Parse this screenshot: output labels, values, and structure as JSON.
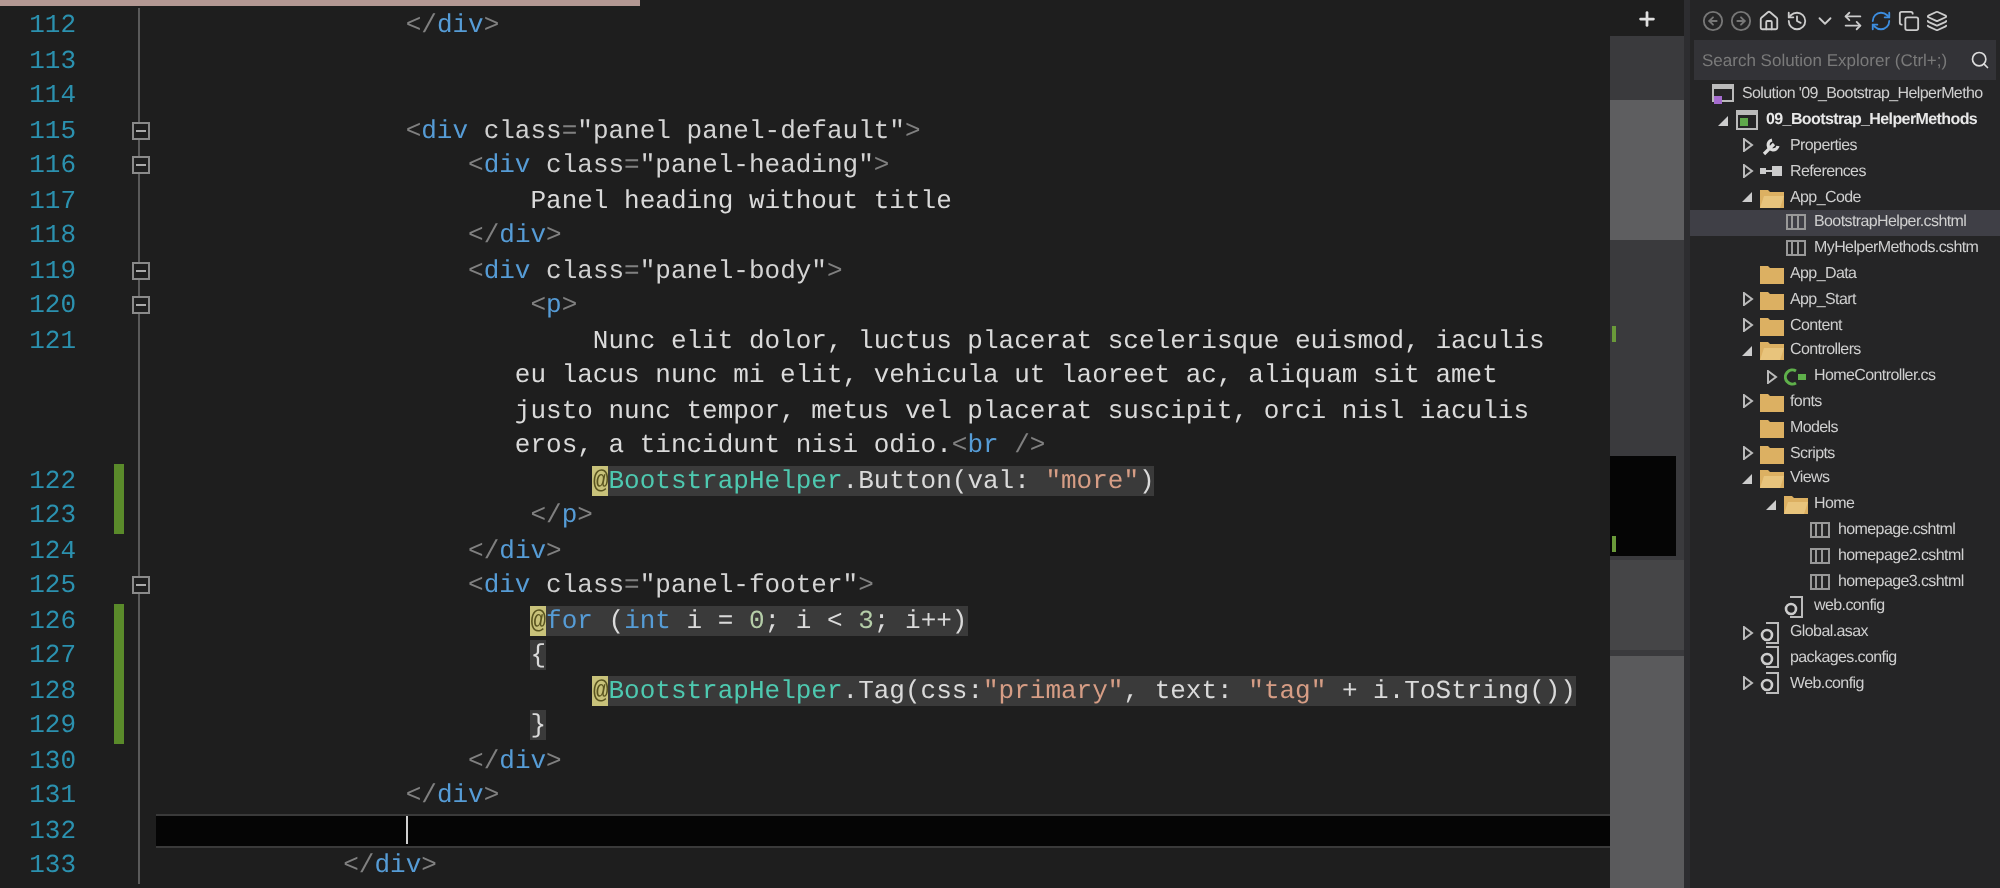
{
  "editor": {
    "lines": [
      {
        "number": "112",
        "changed": false,
        "foldable": false,
        "current": false,
        "razor": false,
        "tokens": [
          {
            "kind": "punct",
            "text": "                </"
          },
          {
            "kind": "tag",
            "text": "div"
          },
          {
            "kind": "punct",
            "text": ">"
          }
        ]
      },
      {
        "number": "113",
        "changed": false,
        "foldable": false,
        "current": false
      },
      {
        "number": "114",
        "changed": false,
        "foldable": false,
        "current": false
      },
      {
        "number": "115",
        "changed": false,
        "foldable": true,
        "current": false,
        "razor": false,
        "tokens": [
          {
            "kind": "punct",
            "text": "                <"
          },
          {
            "kind": "tag",
            "text": "div"
          },
          {
            "kind": "attr",
            "text": " class"
          },
          {
            "kind": "punct",
            "text": "="
          },
          {
            "kind": "value",
            "text": "\"panel panel-default\""
          },
          {
            "kind": "punct",
            "text": ">"
          }
        ]
      },
      {
        "number": "116",
        "changed": false,
        "foldable": true,
        "current": false,
        "razor": false,
        "tokens": [
          {
            "kind": "punct",
            "text": "                    <"
          },
          {
            "kind": "tag",
            "text": "div"
          },
          {
            "kind": "attr",
            "text": " class"
          },
          {
            "kind": "punct",
            "text": "="
          },
          {
            "kind": "value",
            "text": "\"panel-heading\""
          },
          {
            "kind": "punct",
            "text": ">"
          }
        ]
      },
      {
        "number": "117",
        "changed": false,
        "foldable": false,
        "current": false,
        "razor": false,
        "tokens": [
          {
            "kind": "plain",
            "text": "                        Panel heading without title"
          }
        ]
      },
      {
        "number": "118",
        "changed": false,
        "foldable": false,
        "current": false,
        "razor": false,
        "tokens": [
          {
            "kind": "punct",
            "text": "                    </"
          },
          {
            "kind": "tag",
            "text": "div"
          },
          {
            "kind": "punct",
            "text": ">"
          }
        ]
      },
      {
        "number": "119",
        "changed": false,
        "foldable": true,
        "current": false,
        "razor": false,
        "tokens": [
          {
            "kind": "punct",
            "text": "                    <"
          },
          {
            "kind": "tag",
            "text": "div"
          },
          {
            "kind": "attr",
            "text": " class"
          },
          {
            "kind": "punct",
            "text": "="
          },
          {
            "kind": "value",
            "text": "\"panel-body\""
          },
          {
            "kind": "punct",
            "text": ">"
          }
        ]
      },
      {
        "number": "120",
        "changed": false,
        "foldable": true,
        "current": false,
        "razor": false,
        "tokens": [
          {
            "kind": "punct",
            "text": "                        <"
          },
          {
            "kind": "tag",
            "text": "p"
          },
          {
            "kind": "punct",
            "text": ">"
          }
        ]
      },
      {
        "number": "121",
        "changed": false,
        "foldable": false,
        "current": false,
        "razor": false,
        "tokens": [
          {
            "kind": "plain",
            "text": "                            Nunc elit dolor, luctus placerat scelerisque euismod, iaculis"
          }
        ]
      },
      {
        "changed": false,
        "foldable": false,
        "current": false,
        "razor": false,
        "tokens": [
          {
            "kind": "plain",
            "text": "                       eu lacus nunc mi elit, vehicula ut laoreet ac, aliquam sit amet"
          }
        ]
      },
      {
        "changed": false,
        "foldable": false,
        "current": false,
        "razor": false,
        "tokens": [
          {
            "kind": "plain",
            "text": "                       justo nunc tempor, metus vel placerat suscipit, orci nisl iaculis"
          }
        ]
      },
      {
        "changed": false,
        "foldable": false,
        "current": false,
        "razor": false,
        "tokens": [
          {
            "kind": "plain",
            "text": "                       eros, a tincidunt nisi odio."
          },
          {
            "kind": "punct",
            "text": "<"
          },
          {
            "kind": "tag",
            "text": "br"
          },
          {
            "kind": "punct",
            "text": " />"
          }
        ]
      },
      {
        "number": "122",
        "changed": true,
        "foldable": false,
        "current": false,
        "razor": true,
        "tokens": [
          {
            "kind": "marker",
            "text": "                            @"
          },
          {
            "kind": "type",
            "text": "BootstrapHelper"
          },
          {
            "kind": "plain",
            "text": ".Button(val: "
          },
          {
            "kind": "string",
            "text": "\"more\""
          },
          {
            "kind": "plain",
            "text": ")"
          }
        ]
      },
      {
        "number": "123",
        "changed": true,
        "foldable": false,
        "current": false,
        "razor": false,
        "tokens": [
          {
            "kind": "punct",
            "text": "                        </"
          },
          {
            "kind": "tag",
            "text": "p"
          },
          {
            "kind": "punct",
            "text": ">"
          }
        ]
      },
      {
        "number": "124",
        "changed": false,
        "foldable": false,
        "current": false,
        "razor": false,
        "tokens": [
          {
            "kind": "punct",
            "text": "                    </"
          },
          {
            "kind": "tag",
            "text": "div"
          },
          {
            "kind": "punct",
            "text": ">"
          }
        ]
      },
      {
        "number": "125",
        "changed": false,
        "foldable": true,
        "current": false,
        "razor": false,
        "tokens": [
          {
            "kind": "punct",
            "text": "                    <"
          },
          {
            "kind": "tag",
            "text": "div"
          },
          {
            "kind": "attr",
            "text": " class"
          },
          {
            "kind": "punct",
            "text": "="
          },
          {
            "kind": "value",
            "text": "\"panel-footer\""
          },
          {
            "kind": "punct",
            "text": ">"
          }
        ]
      },
      {
        "number": "126",
        "changed": true,
        "foldable": false,
        "current": false,
        "razor": true,
        "tokens": [
          {
            "kind": "marker",
            "text": "                        @"
          },
          {
            "kind": "keyword",
            "text": "for"
          },
          {
            "kind": "plain",
            "text": " ("
          },
          {
            "kind": "keyword",
            "text": "int"
          },
          {
            "kind": "plain",
            "text": " i = "
          },
          {
            "kind": "number",
            "text": "0"
          },
          {
            "kind": "plain",
            "text": "; i < "
          },
          {
            "kind": "number",
            "text": "3"
          },
          {
            "kind": "plain",
            "text": "; i++)"
          }
        ]
      },
      {
        "number": "127",
        "changed": true,
        "foldable": false,
        "current": false,
        "razor": true,
        "tokens": [
          {
            "kind": "plain",
            "text": "                        {"
          }
        ]
      },
      {
        "number": "128",
        "changed": true,
        "foldable": false,
        "current": false,
        "razor": true,
        "tokens": [
          {
            "kind": "marker",
            "text": "                            @"
          },
          {
            "kind": "type",
            "text": "BootstrapHelper"
          },
          {
            "kind": "plain",
            "text": ".Tag(css:"
          },
          {
            "kind": "string",
            "text": "\"primary\""
          },
          {
            "kind": "plain",
            "text": ", text: "
          },
          {
            "kind": "string",
            "text": "\"tag\""
          },
          {
            "kind": "plain",
            "text": " + i.ToString())"
          }
        ]
      },
      {
        "number": "129",
        "changed": true,
        "foldable": false,
        "current": false,
        "razor": true,
        "tokens": [
          {
            "kind": "plain",
            "text": "                        }"
          }
        ]
      },
      {
        "number": "130",
        "changed": false,
        "foldable": false,
        "current": false,
        "razor": false,
        "tokens": [
          {
            "kind": "punct",
            "text": "                    </"
          },
          {
            "kind": "tag",
            "text": "div"
          },
          {
            "kind": "punct",
            "text": ">"
          }
        ]
      },
      {
        "number": "131",
        "changed": false,
        "foldable": false,
        "current": false,
        "razor": false,
        "tokens": [
          {
            "kind": "punct",
            "text": "                </"
          },
          {
            "kind": "tag",
            "text": "div"
          },
          {
            "kind": "punct",
            "text": ">"
          }
        ]
      },
      {
        "number": "132",
        "changed": false,
        "foldable": false,
        "current": true
      },
      {
        "number": "133",
        "changed": false,
        "foldable": false,
        "current": false,
        "razor": false,
        "tokens": [
          {
            "kind": "punct",
            "text": "            </"
          },
          {
            "kind": "tag",
            "text": "div"
          },
          {
            "kind": "punct",
            "text": ">"
          }
        ]
      }
    ]
  },
  "solution_explorer": {
    "search": {
      "placeholder": "Search Solution Explorer (Ctrl+;)"
    },
    "tree": [
      {
        "label": "Solution '09_Bootstrap_HelperMetho",
        "kind": "solution",
        "selected": false,
        "children": [
          {
            "label": "09_Bootstrap_HelperMethods",
            "kind": "project",
            "expanded": true,
            "selected": false,
            "children": [
              {
                "label": "Properties",
                "kind": "wrench",
                "expanded": false,
                "selected": false
              },
              {
                "label": "References",
                "kind": "references",
                "expanded": false,
                "selected": false
              },
              {
                "label": "App_Code",
                "kind": "folder",
                "expanded": true,
                "selected": false,
                "children": [
                  {
                    "label": "BootstrapHelper.cshtml",
                    "kind": "file",
                    "selected": true
                  },
                  {
                    "label": "MyHelperMethods.cshtm",
                    "kind": "file",
                    "selected": false
                  }
                ]
              },
              {
                "label": "App_Data",
                "kind": "folder",
                "selected": false
              },
              {
                "label": "App_Start",
                "kind": "folder",
                "expanded": false,
                "selected": false
              },
              {
                "label": "Content",
                "kind": "folder",
                "expanded": false,
                "selected": false
              },
              {
                "label": "Controllers",
                "kind": "folder",
                "expanded": true,
                "selected": false,
                "children": [
                  {
                    "label": "HomeController.cs",
                    "kind": "cs",
                    "expanded": false,
                    "selected": false
                  }
                ]
              },
              {
                "label": "fonts",
                "kind": "folder",
                "expanded": false,
                "selected": false
              },
              {
                "label": "Models",
                "kind": "folder",
                "selected": false
              },
              {
                "label": "Scripts",
                "kind": "folder",
                "expanded": false,
                "selected": false
              },
              {
                "label": "Views",
                "kind": "folder",
                "expanded": true,
                "selected": false,
                "children": [
                  {
                    "label": "Home",
                    "kind": "folder",
                    "expanded": true,
                    "selected": false,
                    "children": [
                      {
                        "label": "homepage.cshtml",
                        "kind": "file",
                        "selected": false
                      },
                      {
                        "label": "homepage2.cshtml",
                        "kind": "file",
                        "selected": false
                      },
                      {
                        "label": "homepage3.cshtml",
                        "kind": "file",
                        "selected": false
                      }
                    ]
                  },
                  {
                    "label": "web.config",
                    "kind": "config",
                    "selected": false
                  }
                ]
              },
              {
                "label": "Global.asax",
                "kind": "config",
                "expanded": false,
                "selected": false
              },
              {
                "label": "packages.config",
                "kind": "config",
                "selected": false
              },
              {
                "label": "Web.config",
                "kind": "config",
                "expanded": false,
                "selected": false
              }
            ]
          }
        ]
      }
    ]
  }
}
